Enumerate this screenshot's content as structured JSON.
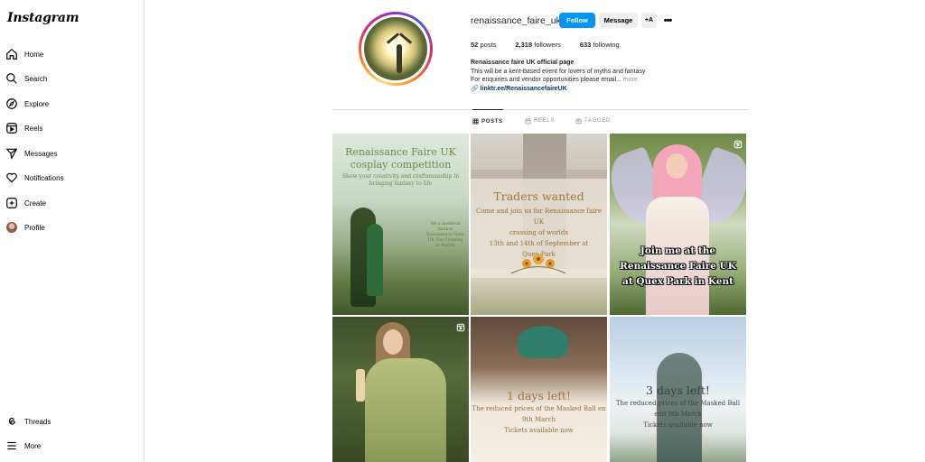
{
  "app": {
    "logo": "Instagram"
  },
  "sidebar": {
    "items": [
      {
        "label": "Home",
        "icon": "home-icon"
      },
      {
        "label": "Search",
        "icon": "search-icon"
      },
      {
        "label": "Explore",
        "icon": "compass-icon"
      },
      {
        "label": "Reels",
        "icon": "reels-icon"
      },
      {
        "label": "Messages",
        "icon": "send-icon"
      },
      {
        "label": "Notifications",
        "icon": "heart-icon"
      },
      {
        "label": "Create",
        "icon": "plus-square-icon"
      },
      {
        "label": "Profile",
        "icon": "avatar"
      }
    ],
    "bottom": [
      {
        "label": "Threads",
        "icon": "threads-icon"
      },
      {
        "label": "More",
        "icon": "menu-icon"
      }
    ]
  },
  "profile": {
    "username": "renaissance_faire_uk",
    "follow_label": "Follow",
    "message_label": "Message",
    "add_user_label": "+A",
    "more_label": "•••",
    "stats": {
      "posts_count": "52",
      "posts_label": "posts",
      "followers_count": "2,318",
      "followers_label": "followers",
      "following_count": "633",
      "following_label": "following"
    },
    "bio": {
      "name": "Renaissance faire UK official page",
      "line1": "This will be a kent-based event for lovers of myths and fantasy",
      "line2": "For enquiries and vendor opportunities please email...",
      "more": "more",
      "link": "linktr.ee/RenaissancefaireUK"
    }
  },
  "tabs": [
    {
      "label": "POSTS",
      "active": true
    },
    {
      "label": "REELS",
      "active": false
    },
    {
      "label": "TAGGED",
      "active": false
    }
  ],
  "posts": [
    {
      "title": "Renaissance Faire UK cosplay competition",
      "subtitle": "Show your creativity and craftsmanship in bringing fantasy to life",
      "side": "We a medieval fantasy Renaissance Faire UK The Crossing of Worlds"
    },
    {
      "title": "Traders wanted",
      "line1": "Come and join us for Renaissance faire UK",
      "line2": "crossing of worlds",
      "line3": "13th and 14th of September at",
      "line4": "Quex Park"
    },
    {
      "line1": "Join me at the",
      "line2": "Renaissance Faire UK",
      "line3": "at Quex Park in Kent"
    },
    {},
    {
      "title": "1 days left!",
      "line1": "The reduced prices of the Masked Ball en",
      "line2": "9th March",
      "line3": "Tickets available now"
    },
    {
      "title": "3 days left!",
      "line1": "The reduced prices of the Masked Ball",
      "line2": "end 9th March",
      "line3": "Tickets available now"
    }
  ],
  "colors": {
    "follow_blue": "#0095f6",
    "link": "#00376b",
    "border": "#dbdbdb"
  }
}
